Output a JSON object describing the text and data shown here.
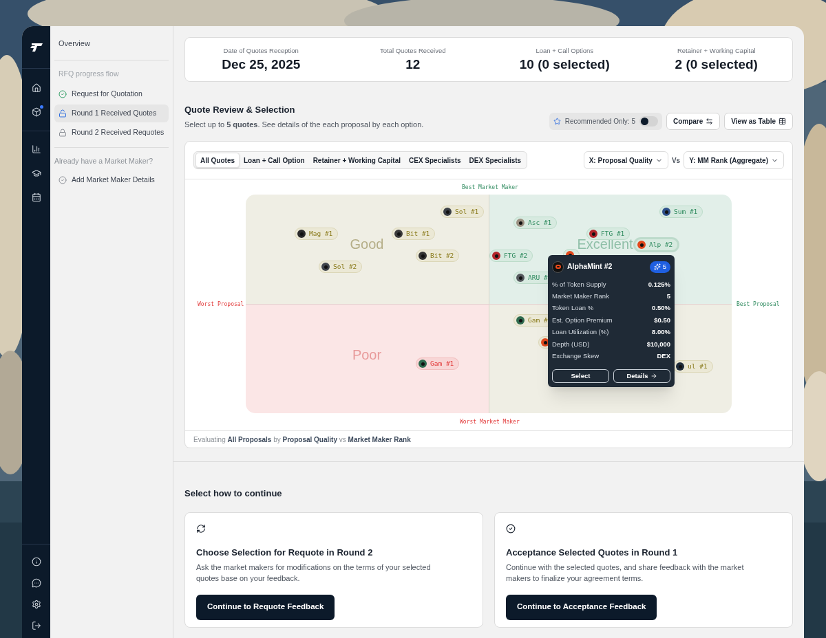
{
  "rail": {
    "top": [
      {
        "kind": "home",
        "notification": false
      },
      {
        "kind": "box",
        "notification": true
      }
    ],
    "middle": [
      {
        "kind": "chart"
      },
      {
        "kind": "graduation"
      },
      {
        "kind": "calendar"
      }
    ],
    "bottom": [
      {
        "kind": "info"
      },
      {
        "kind": "message"
      },
      {
        "kind": "settings"
      },
      {
        "kind": "logout"
      }
    ]
  },
  "sidebar": {
    "overview": "Overview",
    "progress_heading": "RFQ progress flow",
    "progress": [
      {
        "label": "Request for Quotation",
        "kind": "done",
        "selected": false
      },
      {
        "label": "Round 1 Received Quotes",
        "kind": "current",
        "selected": true
      },
      {
        "label": "Round 2 Received Requotes",
        "kind": "locked",
        "selected": false
      }
    ],
    "mm_heading": "Already have a Market Maker?",
    "mm_items": [
      {
        "label": "Add Market Maker Details",
        "kind": "optional",
        "selected": false
      }
    ]
  },
  "stats": [
    {
      "label": "Date of Quotes Reception",
      "value": "Dec 25, 2025"
    },
    {
      "label": "Total Quotes Received",
      "value": "12"
    },
    {
      "label": "Loan + Call Options",
      "value": "10 (0 selected)"
    },
    {
      "label": "Retainer + Working Capital",
      "value": "2 (0 selected)"
    }
  ],
  "review": {
    "title": "Quote Review & Selection",
    "subtitle": "Select up to **5 quotes**. See details of the each proposal by each option.",
    "recommended": {
      "label": "Recommended Only: 5",
      "on": false
    },
    "buttons": [
      {
        "label": "Compare",
        "kind": "compare"
      },
      {
        "label": "View as Table",
        "kind": "table"
      }
    ],
    "tabs": [
      {
        "label": "All Quotes",
        "selected": true
      },
      {
        "label": "Loan + Call Option",
        "selected": false
      },
      {
        "label": "Retainer + Working Capital",
        "selected": false
      },
      {
        "label": "CEX Specialists",
        "selected": false
      },
      {
        "label": "DEX Specialists",
        "selected": false
      }
    ],
    "x_axis": "X: Proposal Quality",
    "vs": "Vs",
    "y_axis": "Y: MM Rank (Aggregate)",
    "axis_labels": {
      "top": "Best Market Maker",
      "bottom": "Worst Market Maker",
      "left": "Worst Proposal",
      "right": "Best Proposal"
    },
    "quadrants": [
      {
        "label": "Good",
        "kind": "good"
      },
      {
        "label": "Excellent",
        "kind": "excellent"
      },
      {
        "label": "Poor",
        "kind": "poor"
      },
      {
        "kind": "good"
      }
    ],
    "pills": [
      {
        "label": "Sol #1",
        "kind": "good",
        "selected": false
      },
      {
        "label": "Mag #1",
        "kind": "good",
        "selected": false
      },
      {
        "label": "Bit #1",
        "kind": "good",
        "selected": false
      },
      {
        "label": "Bit #2",
        "kind": "good",
        "selected": false
      },
      {
        "label": "Sol #2",
        "kind": "good",
        "selected": false
      },
      {
        "label": "Gam #1",
        "kind": "poor",
        "selected": false
      },
      {
        "label": "Sum #1",
        "kind": "excellent",
        "selected": false
      },
      {
        "label": "Asc #1",
        "kind": "excellent",
        "selected": false
      },
      {
        "label": "FTG #1",
        "kind": "excellent",
        "selected": false
      },
      {
        "label": "Alp #2",
        "kind": "excellent",
        "selected": true
      },
      {
        "label": "FTG #2",
        "kind": "excellent",
        "selected": false
      },
      {
        "kind": "excellent",
        "selected": false
      },
      {
        "label": "ARU #",
        "kind": "excellent",
        "selected": false
      },
      {
        "label": "Gam #",
        "kind": "good",
        "selected": false
      },
      {
        "kind": "good",
        "selected": false
      },
      {
        "label": "ul #1",
        "kind": "good",
        "selected": false
      }
    ],
    "tooltip": {
      "title": "AlphaMint #2",
      "badge": "5",
      "rows": [
        {
          "label": "% of Token Supply",
          "value": "0.125%"
        },
        {
          "label": "Market Maker Rank",
          "value": "5"
        },
        {
          "label": "Token Loan %",
          "value": "0.50%"
        },
        {
          "label": "Est. Option Premium",
          "value": "$0.50"
        },
        {
          "label": "Loan Utilization (%)",
          "value": "8.00%"
        },
        {
          "label": "Depth (USD)",
          "value": "$10,000"
        },
        {
          "label": "Exchange Skew",
          "value": "DEX"
        }
      ],
      "buttons": [
        {
          "label": "Select",
          "kind": "plain"
        },
        {
          "label": "Details",
          "kind": "arrow"
        }
      ]
    },
    "footer": "Evaluating **All Proposals** by **Proposal Quality** vs **Market Maker Rank**"
  },
  "continue": {
    "title": "Select how to continue",
    "options": [
      {
        "kind": "requote",
        "title": "Choose Selection for Requote in Round 2",
        "description": "Ask the market makers for modifications on the terms of your selected quotes base on your feedback.",
        "button": "Continue to Requote Feedback"
      },
      {
        "kind": "accept",
        "title": "Acceptance Selected Quotes in Round 1",
        "description": "Continue with the selected quotes, and share feedback with the market makers to finalize your agreement terms.",
        "button": "Continue to Acceptance Feedback"
      }
    ]
  }
}
